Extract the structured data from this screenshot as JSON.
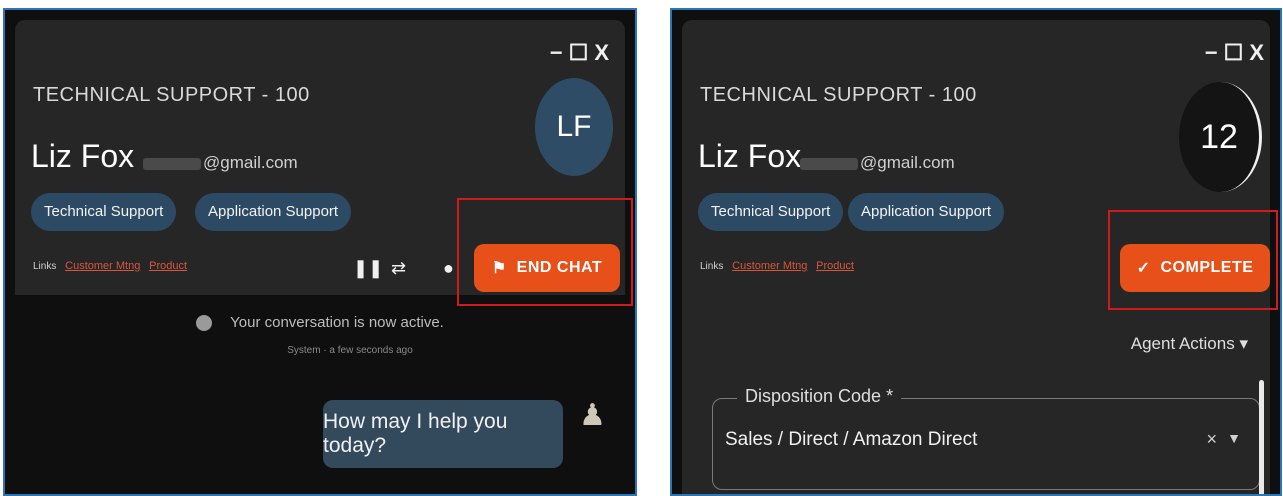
{
  "left": {
    "window_controls": {
      "minimize": "−",
      "maximize": "☐",
      "close": "X"
    },
    "queue_title": "TECHNICAL SUPPORT - 100",
    "customer_name": "Liz Fox",
    "customer_email": "@gmail.com",
    "tags": [
      "Technical Support",
      "Application Support"
    ],
    "links_label": "Links",
    "links": [
      "Customer Mtng",
      "Product"
    ],
    "avatar_initials": "LF",
    "end_chat_label": "END CHAT",
    "system_message": "Your conversation is now active.",
    "system_meta": "System · a few seconds ago",
    "agent_message": "How may I help you today?"
  },
  "right": {
    "window_controls": {
      "minimize": "−",
      "maximize": "☐",
      "close": "X"
    },
    "queue_title": "TECHNICAL SUPPORT - 100",
    "customer_name": "Liz Fox",
    "customer_email": "@gmail.com",
    "tags": [
      "Technical Support",
      "Application Support"
    ],
    "links_label": "Links",
    "links": [
      "Customer Mtng",
      "Product"
    ],
    "timer_value": "12",
    "complete_label": "COMPLETE",
    "agent_actions_label": "Agent Actions",
    "disposition": {
      "label": "Disposition Code *",
      "value": "Sales / Direct / Amazon Direct",
      "clear": "×"
    }
  },
  "colors": {
    "accent_button": "#e8501a",
    "highlight_box": "#d11a1a",
    "chip_bg": "#2c4a63",
    "panel_border": "#2f74b5"
  }
}
